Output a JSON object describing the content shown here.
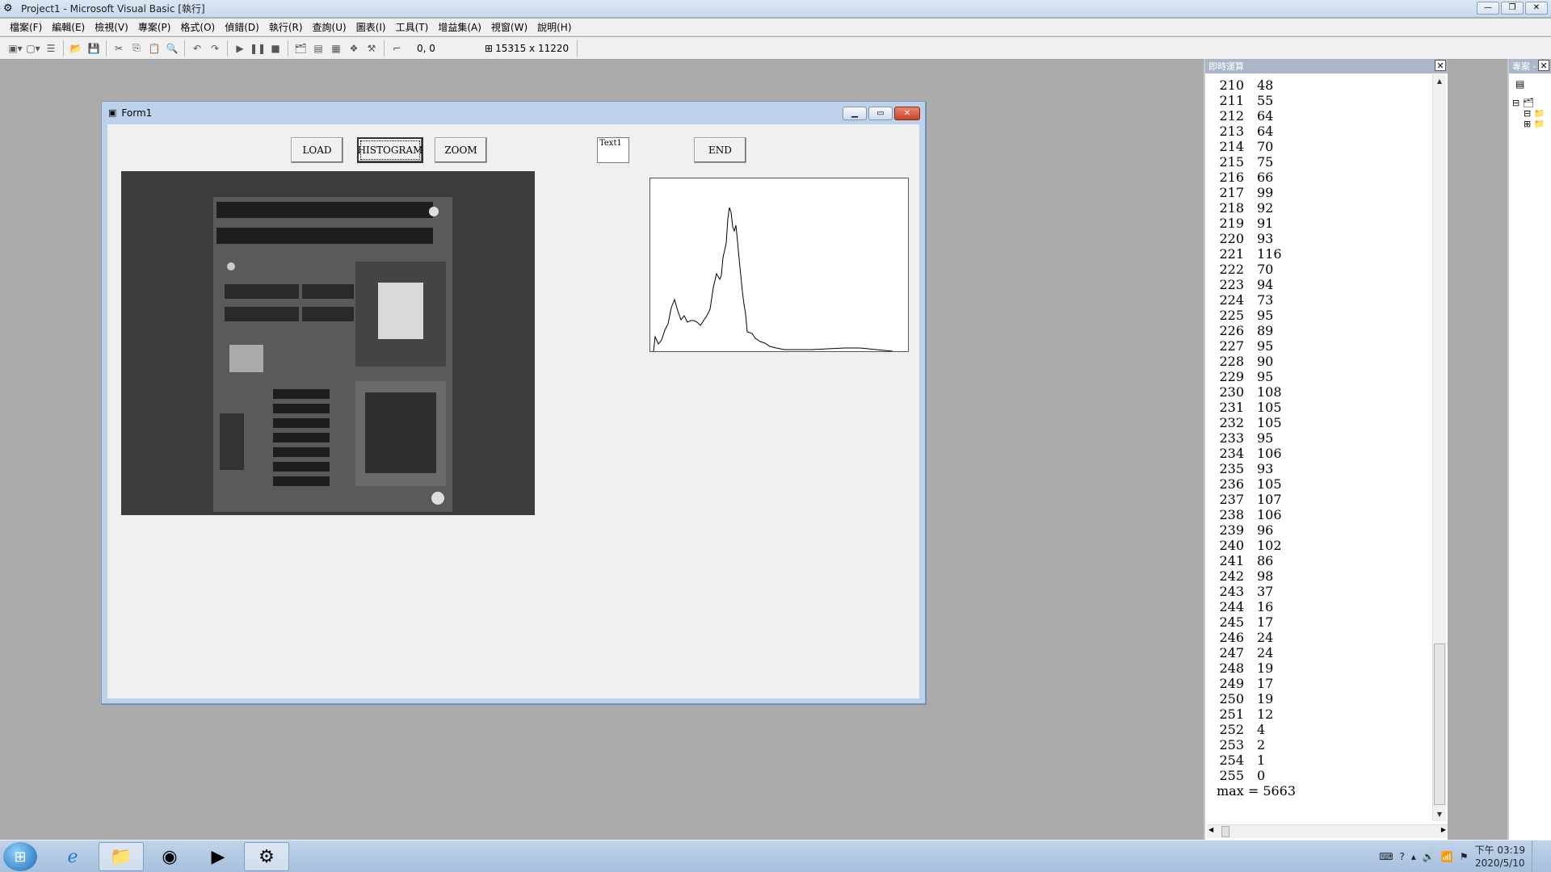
{
  "window": {
    "title": "Project1 - Microsoft Visual Basic [執行]",
    "controls": [
      "—",
      "❐",
      "✕"
    ]
  },
  "menu": [
    "檔案(F)",
    "編輯(E)",
    "檢視(V)",
    "專案(P)",
    "格式(O)",
    "偵錯(D)",
    "執行(R)",
    "查詢(U)",
    "圖表(I)",
    "工具(T)",
    "增益集(A)",
    "視窗(W)",
    "說明(H)"
  ],
  "toolbar": {
    "position_readout": "0, 0",
    "size_readout": "15315 x 11220"
  },
  "form": {
    "title": "Form1",
    "load_label": "LOAD",
    "histogram_label": "HISTOGRAM",
    "zoom_label": "ZOOM",
    "textbox_value": "Text1",
    "end_label": "END"
  },
  "immediate": {
    "title": "即時運算",
    "rows": [
      [
        "210",
        "48"
      ],
      [
        "211",
        "55"
      ],
      [
        "212",
        "64"
      ],
      [
        "213",
        "64"
      ],
      [
        "214",
        "70"
      ],
      [
        "215",
        "75"
      ],
      [
        "216",
        "66"
      ],
      [
        "217",
        "99"
      ],
      [
        "218",
        "92"
      ],
      [
        "219",
        "91"
      ],
      [
        "220",
        "93"
      ],
      [
        "221",
        "116"
      ],
      [
        "222",
        "70"
      ],
      [
        "223",
        "94"
      ],
      [
        "224",
        "73"
      ],
      [
        "225",
        "95"
      ],
      [
        "226",
        "89"
      ],
      [
        "227",
        "95"
      ],
      [
        "228",
        "90"
      ],
      [
        "229",
        "95"
      ],
      [
        "230",
        "108"
      ],
      [
        "231",
        "105"
      ],
      [
        "232",
        "105"
      ],
      [
        "233",
        "95"
      ],
      [
        "234",
        "106"
      ],
      [
        "235",
        "93"
      ],
      [
        "236",
        "105"
      ],
      [
        "237",
        "107"
      ],
      [
        "238",
        "106"
      ],
      [
        "239",
        "96"
      ],
      [
        "240",
        "102"
      ],
      [
        "241",
        "86"
      ],
      [
        "242",
        "98"
      ],
      [
        "243",
        "37"
      ],
      [
        "244",
        "16"
      ],
      [
        "245",
        "17"
      ],
      [
        "246",
        "24"
      ],
      [
        "247",
        "24"
      ],
      [
        "248",
        "19"
      ],
      [
        "249",
        "17"
      ],
      [
        "250",
        "19"
      ],
      [
        "251",
        "12"
      ],
      [
        "252",
        "4"
      ],
      [
        "253",
        "2"
      ],
      [
        "254",
        "1"
      ],
      [
        "255",
        "0"
      ]
    ],
    "max_line": "max  =  5663"
  },
  "project": {
    "title": "專案 -"
  },
  "taskbar": {
    "apps": [
      "Internet Explorer",
      "File Explorer",
      "Google Chrome",
      "Media Player",
      "Visual Basic"
    ],
    "time": "下午 03:19",
    "date": "2020/5/10"
  }
}
